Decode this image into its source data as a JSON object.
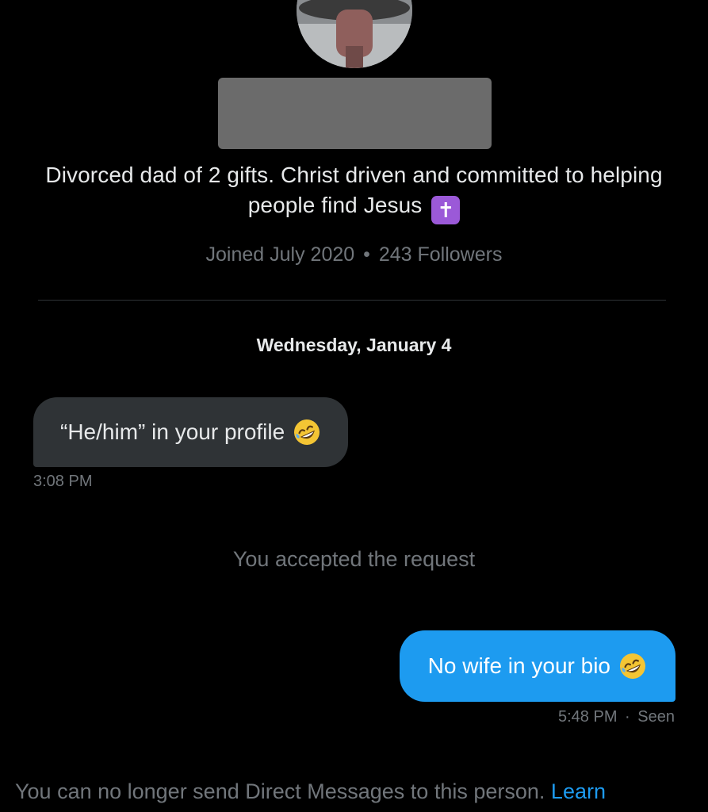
{
  "profile": {
    "bio": "Divorced dad of 2 gifts. Christ driven and committed to helping people find Jesus",
    "bio_emoji": "✝",
    "joined": "Joined July 2020",
    "separator": "•",
    "followers": "243 Followers"
  },
  "conversation": {
    "date": "Wednesday, January 4",
    "incoming": {
      "text": "“He/him” in your profile",
      "emoji": "rolling-on-floor-laughing",
      "time": "3:08 PM"
    },
    "system_note": "You accepted the request",
    "outgoing": {
      "text": "No wife in your bio",
      "emoji": "rolling-on-floor-laughing",
      "time": "5:48 PM",
      "separator": "·",
      "status": "Seen"
    }
  },
  "footer": {
    "notice": "You can no longer send Direct Messages to this person.",
    "link": "Learn"
  },
  "colors": {
    "background": "#000000",
    "accent": "#1d9bf0",
    "incoming_bubble": "#2f3336",
    "muted_text": "#71767b"
  }
}
